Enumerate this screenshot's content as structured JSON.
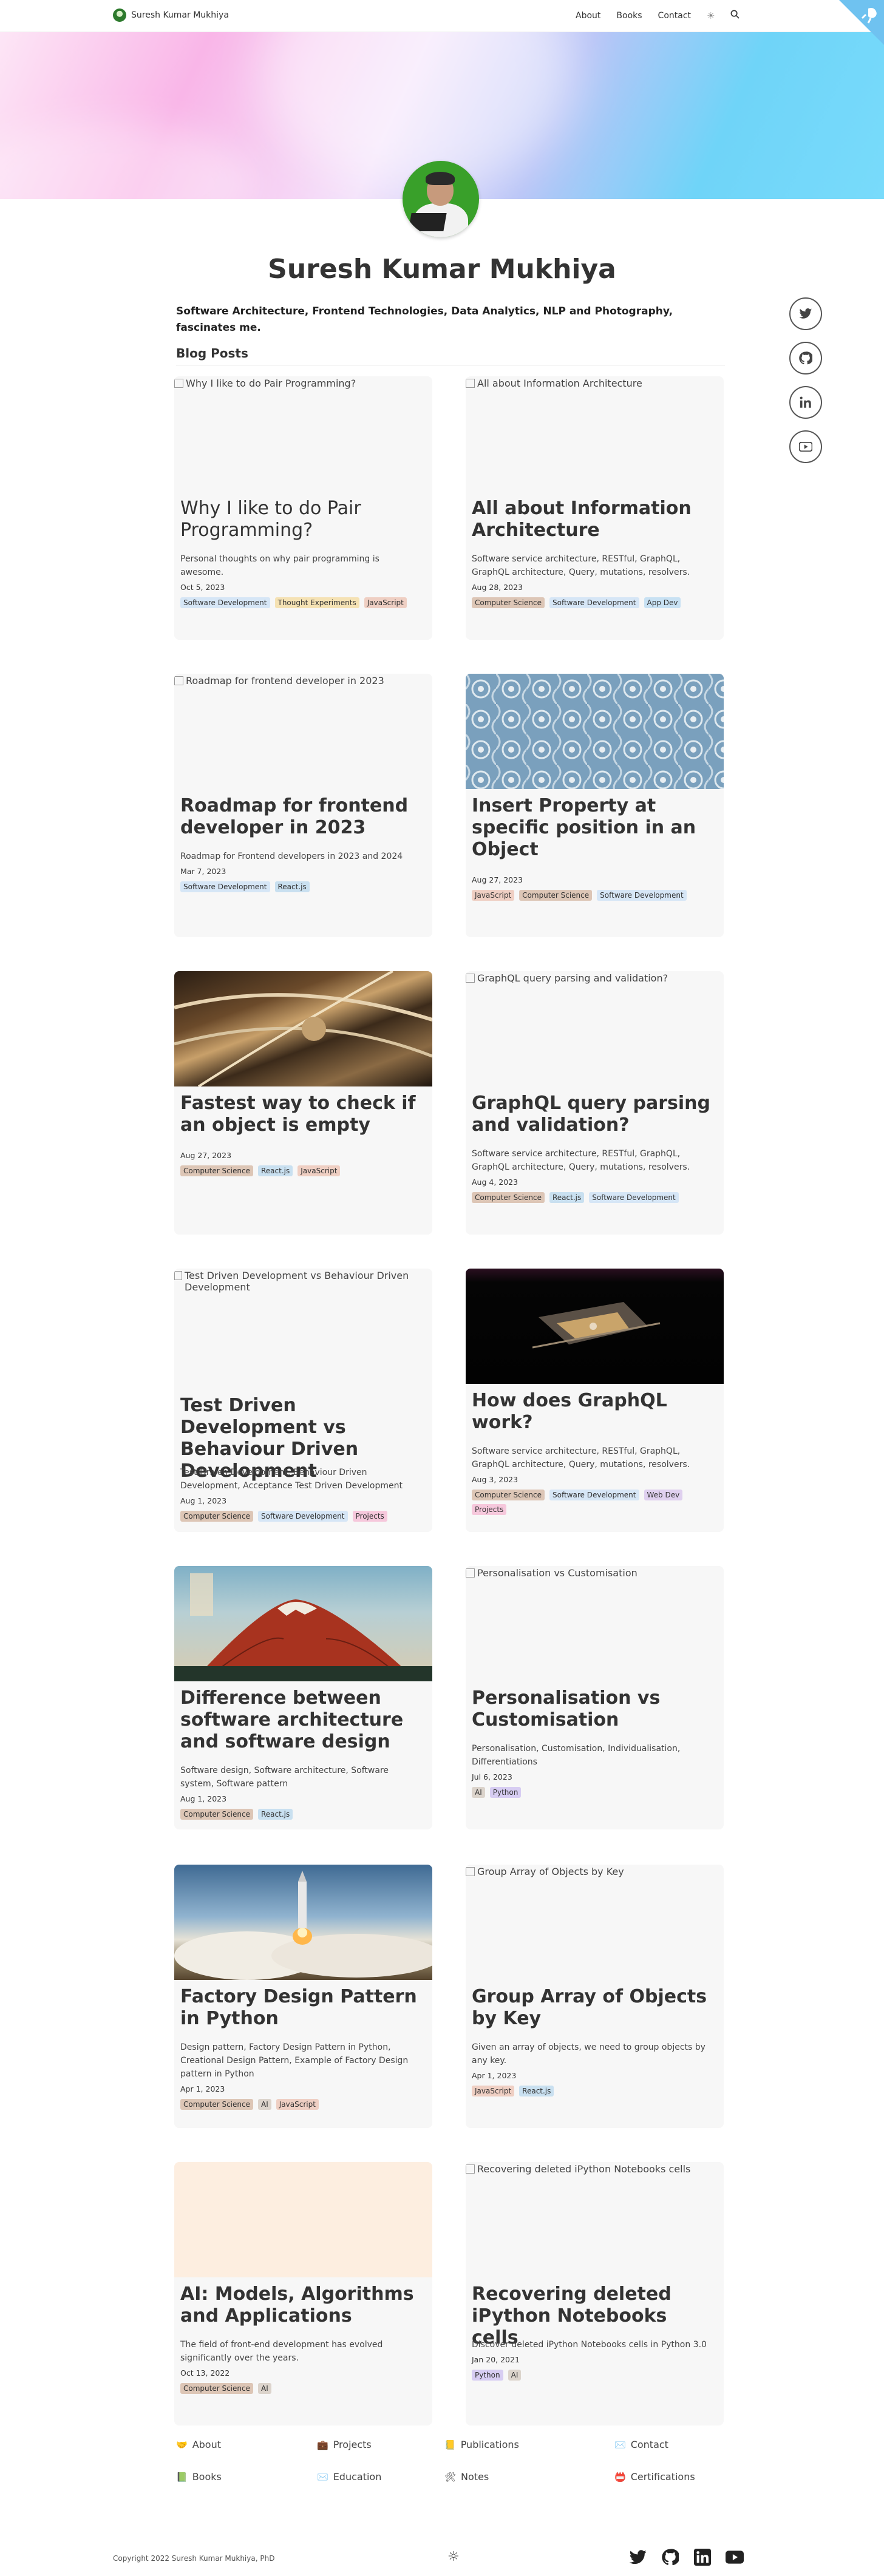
{
  "header": {
    "brand": "Suresh Kumar Mukhiya",
    "nav": [
      "About",
      "Books",
      "Contact"
    ],
    "theme_icon": "sun-icon",
    "search_icon": "search-icon",
    "corner_icon": "github-octocat-icon"
  },
  "profile": {
    "name": "Suresh Kumar Mukhiya",
    "bio": "Software Architecture, Frontend Technologies, Data Analytics, NLP and Photography, fascinates me."
  },
  "section_title": "Blog Posts",
  "social": [
    "twitter-icon",
    "github-icon",
    "linkedin-icon",
    "youtube-icon"
  ],
  "posts": [
    {
      "alt": "Why I like to do Pair Programming?",
      "title": "Why I like to do Pair Programming?",
      "desc": "Personal thoughts on why pair programming is awesome.",
      "date": "Oct 5, 2023",
      "tags": [
        "Software Development",
        "Thought Experiments",
        "JavaScript"
      ]
    },
    {
      "alt": "All about Information Architecture",
      "title": "All about Information Architecture",
      "desc": "Software service architecture, RESTful, GraphQL, GraphQL architecture, Query, mutations, resolvers.",
      "date": "Aug 28, 2023",
      "tags": [
        "Computer Science",
        "Software Development",
        "App Dev"
      ]
    },
    {
      "alt": "Roadmap for frontend developer in 2023",
      "title": "Roadmap for frontend developer in 2023",
      "desc": "Roadmap for Frontend developers in 2023 and 2024",
      "date": "Mar 7, 2023",
      "tags": [
        "Software Development",
        "React.js"
      ]
    },
    {
      "alt": "",
      "title": "Insert Property at specific position in an Object",
      "desc": "",
      "date": "Aug 27, 2023",
      "tags": [
        "JavaScript",
        "Computer Science",
        "Software Development"
      ]
    },
    {
      "alt": "",
      "title": "Fastest way to check if an object is empty",
      "desc": "",
      "date": "Aug 27, 2023",
      "tags": [
        "Computer Science",
        "React.js",
        "JavaScript"
      ]
    },
    {
      "alt": "GraphQL query parsing and validation?",
      "title": "GraphQL query parsing and validation?",
      "desc": "Software service architecture, RESTful, GraphQL, GraphQL architecture, Query, mutations, resolvers.",
      "date": "Aug 4, 2023",
      "tags": [
        "Computer Science",
        "React.js",
        "Software Development"
      ]
    },
    {
      "alt": "Test Driven Development vs Behaviour Driven Development",
      "title": "Test Driven Development vs Behaviour Driven Development",
      "desc": "Test Driven Development, Behaviour Driven Development, Acceptance Test Driven Development",
      "date": "Aug 1, 2023",
      "tags": [
        "Computer Science",
        "Software Development",
        "Projects"
      ]
    },
    {
      "alt": "",
      "title": "How does GraphQL work?",
      "desc": "Software service architecture, RESTful, GraphQL, GraphQL architecture, Query, mutations, resolvers.",
      "date": "Aug 3, 2023",
      "tags": [
        "Computer Science",
        "Software Development",
        "Web Dev",
        "Projects"
      ]
    },
    {
      "alt": "",
      "title": "Difference between software architecture and software design",
      "desc": "Software design, Software architecture, Software system, Software pattern",
      "date": "Aug 1, 2023",
      "tags": [
        "Computer Science",
        "React.js"
      ]
    },
    {
      "alt": "Personalisation vs Customisation",
      "title": "Personalisation vs Customisation",
      "desc": "Personalisation, Customisation, Individualisation, Differentiations",
      "date": "Jul 6, 2023",
      "tags": [
        "AI",
        "Python"
      ]
    },
    {
      "alt": "",
      "title": "Factory Design Pattern in Python",
      "desc": "Design pattern, Factory Design Pattern in Python, Creational Design Pattern, Example of Factory Design pattern in Python",
      "date": "Apr 1, 2023",
      "tags": [
        "Computer Science",
        "AI",
        "JavaScript"
      ]
    },
    {
      "alt": "Group Array of Objects by Key",
      "title": "Group Array of Objects by Key",
      "desc": "Given an array of objects, we need to group objects by any key.",
      "date": "Apr 1, 2023",
      "tags": [
        "JavaScript",
        "React.js"
      ]
    },
    {
      "alt": "",
      "title": "AI: Models, Algorithms and Applications",
      "desc": "The field of front-end development has evolved significantly over the years.",
      "date": "Oct 13, 2022",
      "tags": [
        "Computer Science",
        "AI"
      ]
    },
    {
      "alt": "Recovering deleted iPython Notebooks cells",
      "title": "Recovering deleted iPython Notebooks cells",
      "desc": "Discover deleted iPython Notebooks cells in Python 3.0",
      "date": "Jan 20, 2021",
      "tags": [
        "Python",
        "AI"
      ]
    }
  ],
  "footer": {
    "links": [
      {
        "emoji": "🤝",
        "label": "About"
      },
      {
        "emoji": "💼",
        "label": "Projects"
      },
      {
        "emoji": "📒",
        "label": "Publications"
      },
      {
        "emoji": "✉️",
        "label": "Contact"
      },
      {
        "emoji": "📗",
        "label": "Books"
      },
      {
        "emoji": "✉️",
        "label": "Education"
      },
      {
        "emoji": "🛠",
        "label": "Notes"
      },
      {
        "emoji": "📛",
        "label": "Certifications"
      }
    ],
    "copyright": "Copyright 2022 Suresh Kumar Mukhiya, PhD",
    "icons": [
      "twitter-icon",
      "github-icon",
      "linkedin-icon",
      "youtube-icon"
    ]
  }
}
